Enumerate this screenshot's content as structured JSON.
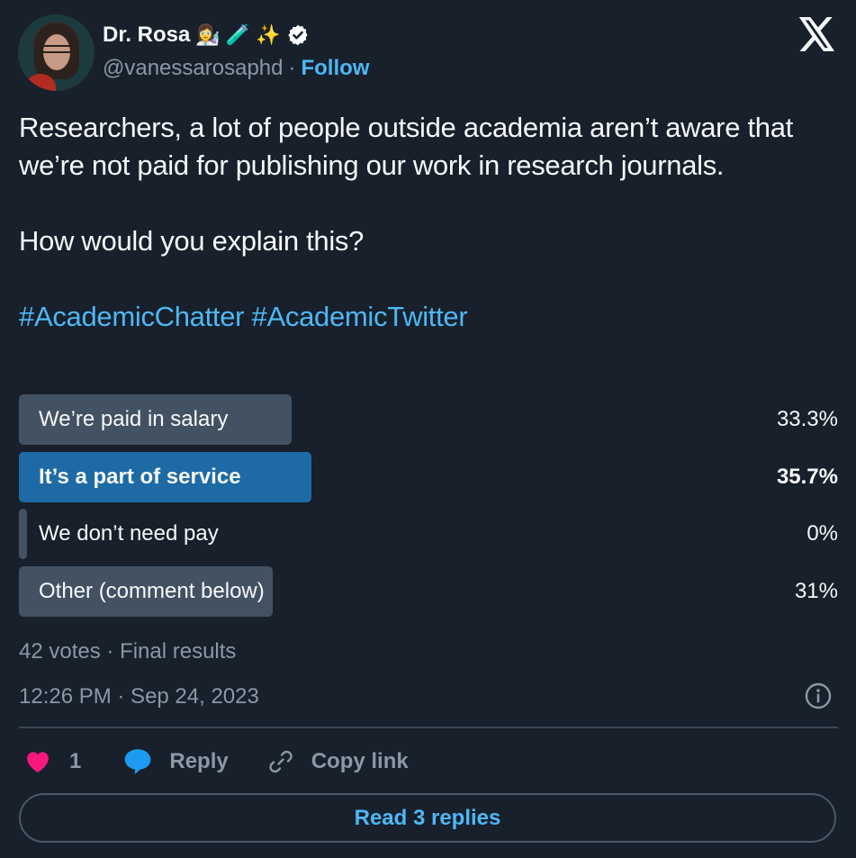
{
  "author": {
    "display_name": "Dr. Rosa",
    "emojis": [
      "👩‍🔬",
      "🧪",
      "✨"
    ],
    "verified": true,
    "handle": "@vanessarosaphd",
    "separator": "·",
    "follow_label": "Follow",
    "avatar_icon": "profile-photo"
  },
  "brand": {
    "logo": "x-logo"
  },
  "tweet": {
    "paragraphs": [
      "Researchers, a lot of people outside academia aren’t aware that we’re not paid for publishing our work in research journals.",
      "How would you explain this?"
    ],
    "hashtags": [
      "#AcademicChatter",
      "#AcademicTwitter"
    ]
  },
  "poll": {
    "options": [
      {
        "label": "We’re paid in salary",
        "percent_label": "33.3%",
        "percent": 33.3,
        "winner": false
      },
      {
        "label": "It’s a part of service",
        "percent_label": "35.7%",
        "percent": 35.7,
        "winner": true
      },
      {
        "label": "We don’t need pay",
        "percent_label": "0%",
        "percent": 0,
        "winner": false
      },
      {
        "label": "Other (comment below)",
        "percent_label": "31%",
        "percent": 31,
        "winner": false
      }
    ],
    "meta": "42 votes · Final results",
    "colors": {
      "winner": "#1e6aa5",
      "other": "#435263"
    }
  },
  "timestamp": "12:26 PM · Sep 24, 2023",
  "actions": {
    "like_count": "1",
    "reply_label": "Reply",
    "copy_link_label": "Copy link"
  },
  "read_replies_label": "Read 3 replies",
  "colors": {
    "background": "#17202b",
    "accent": "#4fb7f4",
    "like": "#f91880",
    "reply": "#1d9bf0",
    "muted": "#8b98a5"
  }
}
